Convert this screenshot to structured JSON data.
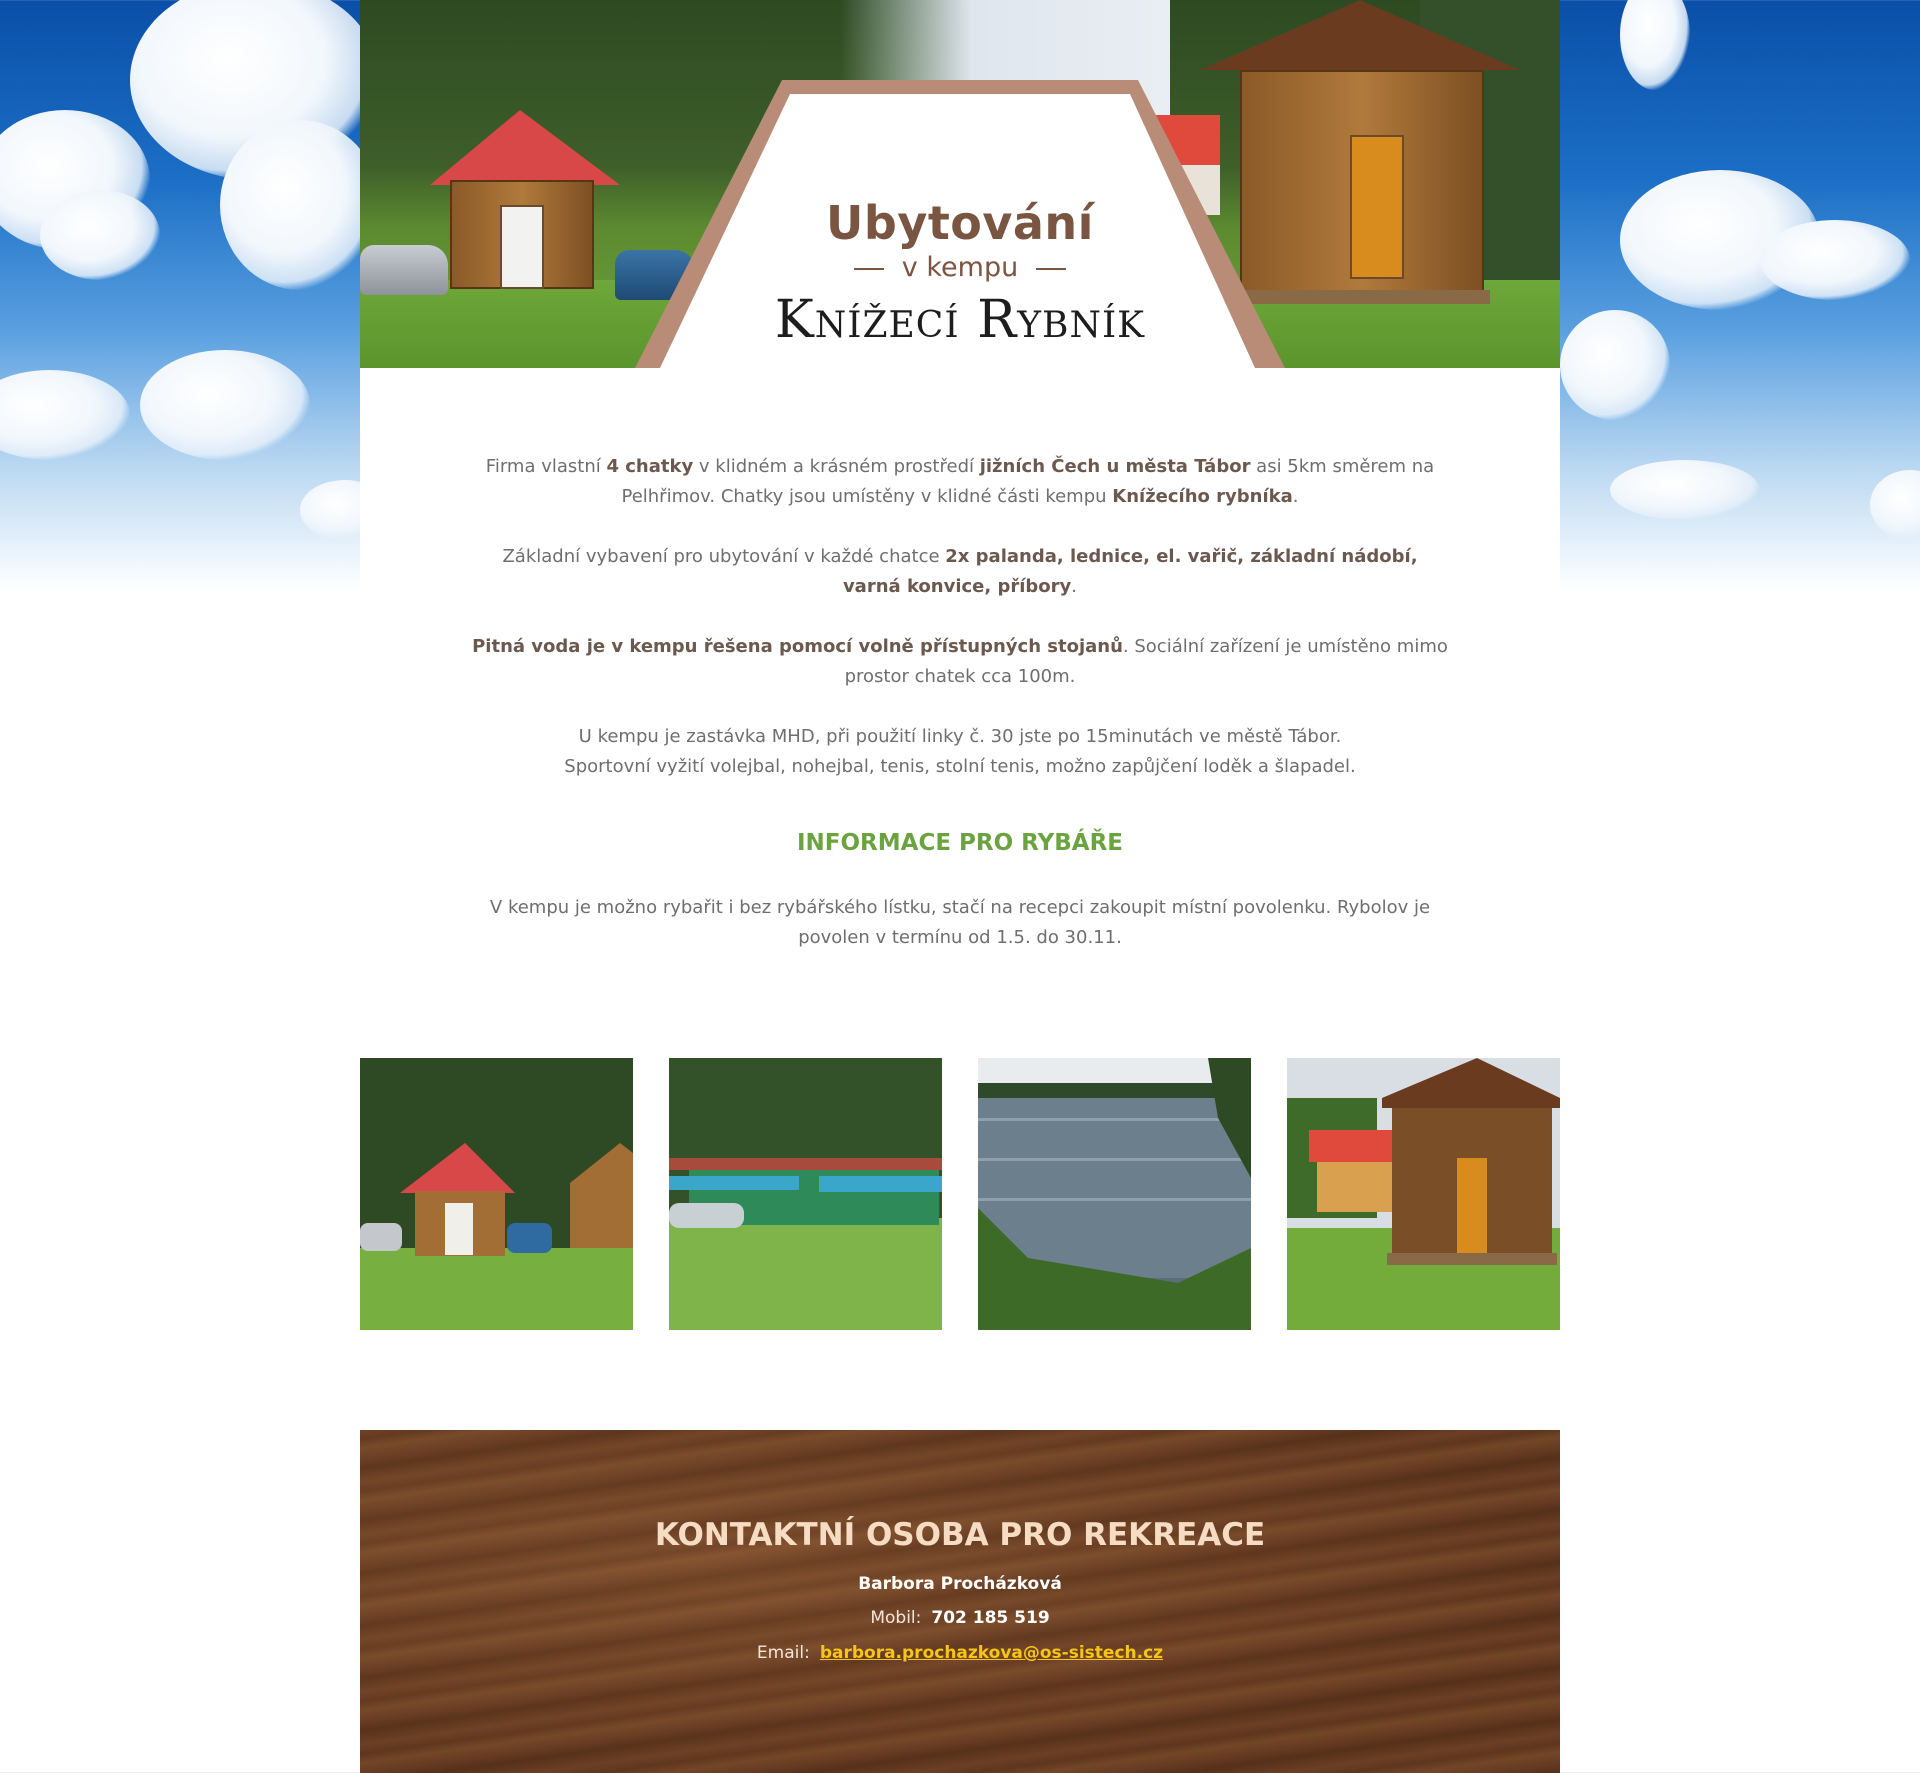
{
  "hero": {
    "title": "Ubytování",
    "subtitle": "v kempu",
    "name": "Knížecí Rybník"
  },
  "intro": {
    "p1": {
      "t1": "Firma vlastní ",
      "b1": "4 chatky",
      "t2": " v klidném a krásném prostředí ",
      "b2": "jižních Čech u města Tábor",
      "t3": " asi 5km směrem na Pelhřimov.  Chatky jsou umístěny v klidné části kempu  ",
      "b3": "Knížecího rybníka",
      "t4": "."
    },
    "p2": {
      "t1": "Základní vybavení pro ubytování v každé chatce ",
      "b1": "2x palanda, lednice, el. vařič, základní nádobí, varná konvice, příbory",
      "t2": "."
    },
    "p3": {
      "b1": "Pitná voda je v kempu řešena pomocí volně  přístupných stojanů",
      "t1": ". Sociální zařízení je umístěno mimo prostor chatek cca 100m."
    },
    "p4": {
      "line1": "U kempu je zastávka MHD, při použití linky č. 30 jste po 15minutách ve městě Tábor.",
      "line2": "Sportovní vyžití volejbal, nohejbal, tenis, stolní tenis, možno zapůjčení loděk a šlapadel."
    }
  },
  "fishing": {
    "heading": "INFORMACE PRO RYBÁŘE",
    "text": "V kempu je možno rybařit i bez rybářského lístku, stačí na recepci zakoupit místní povolenku. Rybolov je povolen v termínu od 1.5. do 30.11."
  },
  "gallery": {
    "photos": [
      "cabins-photo",
      "green-cabins-photo",
      "pond-photo",
      "wooden-cabin-photo"
    ]
  },
  "contact": {
    "heading": "KONTAKTNÍ OSOBA PRO REKREACE",
    "name": "Barbora Procházková",
    "mobile_label": "Mobil:",
    "mobile": "702  185 519",
    "email_label": "Email:",
    "email": "barbora.prochazkova@os-sistech.cz"
  },
  "colors": {
    "title_brown": "#7a5541",
    "fishing_green": "#6aa33f",
    "email_yellow": "#f5c518",
    "contact_heading": "#f6dcc3"
  }
}
